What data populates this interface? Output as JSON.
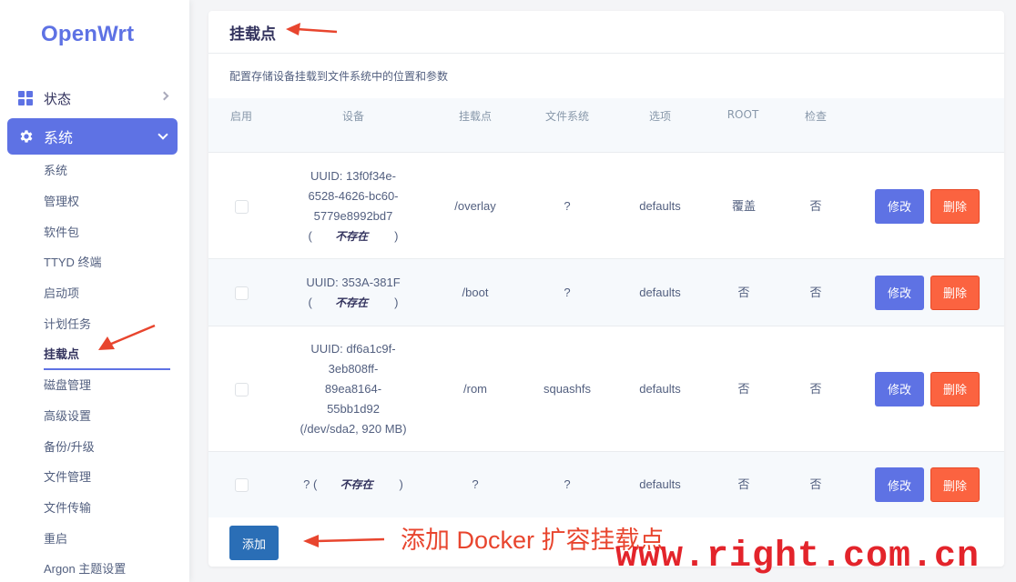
{
  "brand": "OpenWrt",
  "sidebar": {
    "status_label": "状态",
    "system_label": "系统",
    "items": [
      "系统",
      "管理权",
      "软件包",
      "TTYD 终端",
      "启动项",
      "计划任务",
      "挂载点",
      "磁盘管理",
      "高级设置",
      "备份/升级",
      "文件管理",
      "文件传输",
      "重启",
      "Argon 主题设置"
    ],
    "active_item": "挂载点"
  },
  "main": {
    "title": "挂载点",
    "description": "配置存储设备挂载到文件系统中的位置和参数",
    "columns": [
      "启用",
      "设备",
      "挂载点",
      "文件系统",
      "选项",
      "ROOT",
      "检查"
    ],
    "rows": [
      {
        "device_lines": [
          "UUID: 13f0f34e-",
          "6528-4626-bc60-",
          "5779e8992bd7"
        ],
        "device_status_open": "(",
        "device_status": "不存在",
        "device_status_close": ")",
        "mountpoint": "/overlay",
        "fs": "?",
        "options": "defaults",
        "root": "覆盖",
        "check": "否"
      },
      {
        "device_lines": [
          "UUID: 353A-381F"
        ],
        "device_status_open": "(",
        "device_status": "不存在",
        "device_status_close": ")",
        "mountpoint": "/boot",
        "fs": "?",
        "options": "defaults",
        "root": "否",
        "check": "否"
      },
      {
        "device_lines": [
          "UUID: df6a1c9f-",
          "3eb808ff-",
          "89ea8164-",
          "55bb1d92",
          "(/dev/sda2, 920 MB)"
        ],
        "mountpoint": "/rom",
        "fs": "squashfs",
        "options": "defaults",
        "root": "否",
        "check": "否"
      },
      {
        "device_prefix": "? (",
        "device_status": "不存在",
        "device_status_close": ")",
        "mountpoint": "?",
        "fs": "?",
        "options": "defaults",
        "root": "否",
        "check": "否"
      }
    ],
    "edit_label": "修改",
    "delete_label": "删除",
    "add_label": "添加"
  },
  "annotation": "添加 Docker 扩容挂载点",
  "watermark": "www.right.com.cn",
  "colors": {
    "accent": "#5e72e4",
    "danger": "#fb6340",
    "add": "#2a6eb6",
    "annotation": "#e8452e"
  }
}
